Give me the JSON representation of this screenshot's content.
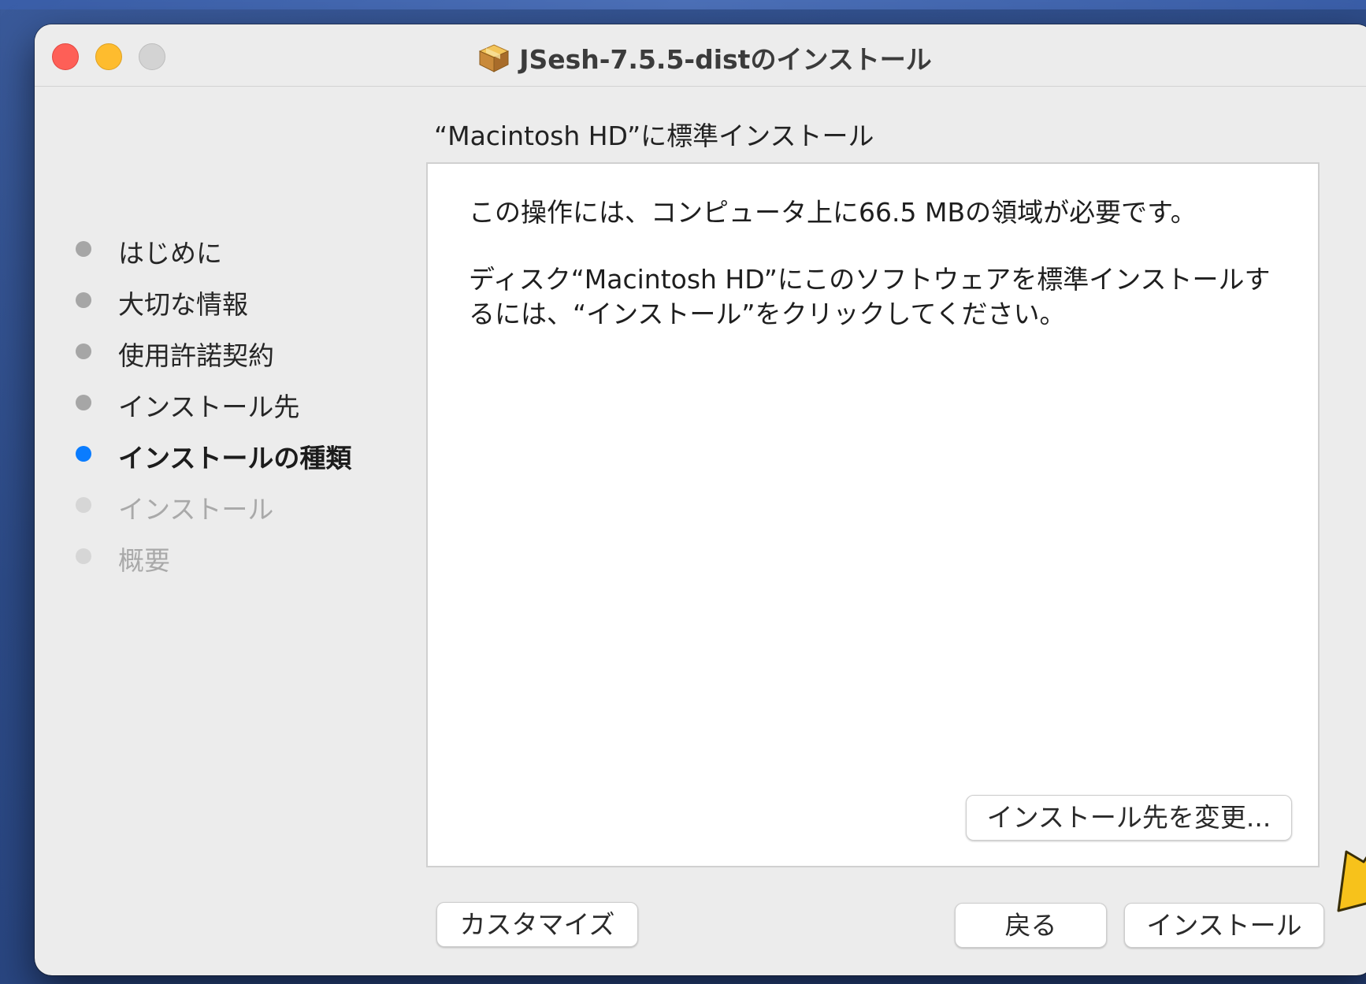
{
  "window": {
    "title": "JSesh-7.5.5-distのインストール"
  },
  "icons": {
    "window_icon": "package-icon",
    "close": "close-button",
    "minimize": "minimize-button",
    "zoom": "zoom-button",
    "annotation": "arrow-pointer-icon"
  },
  "colors": {
    "current_step": "#0a7cff",
    "arrow": "#f7c21b",
    "close": "#fe5f57",
    "minimize": "#febc2e"
  },
  "sidebar": {
    "steps": [
      {
        "label": "はじめに",
        "state": "done"
      },
      {
        "label": "大切な情報",
        "state": "done"
      },
      {
        "label": "使用許諾契約",
        "state": "done"
      },
      {
        "label": "インストール先",
        "state": "done"
      },
      {
        "label": "インストールの種類",
        "state": "current"
      },
      {
        "label": "インストール",
        "state": "future"
      },
      {
        "label": "概要",
        "state": "future"
      }
    ]
  },
  "main": {
    "heading": "“Macintosh HD”に標準インストール",
    "paragraph1": "この操作には、コンピュータ上に66.5 MBの領域が必要です。",
    "paragraph2": "ディスク“Macintosh HD”にこのソフトウェアを標準インストールするには、“インストール”をクリックしてください。",
    "change_location_label": "インストール先を変更..."
  },
  "footer": {
    "customize_label": "カスタマイズ",
    "back_label": "戻る",
    "install_label": "インストール"
  }
}
